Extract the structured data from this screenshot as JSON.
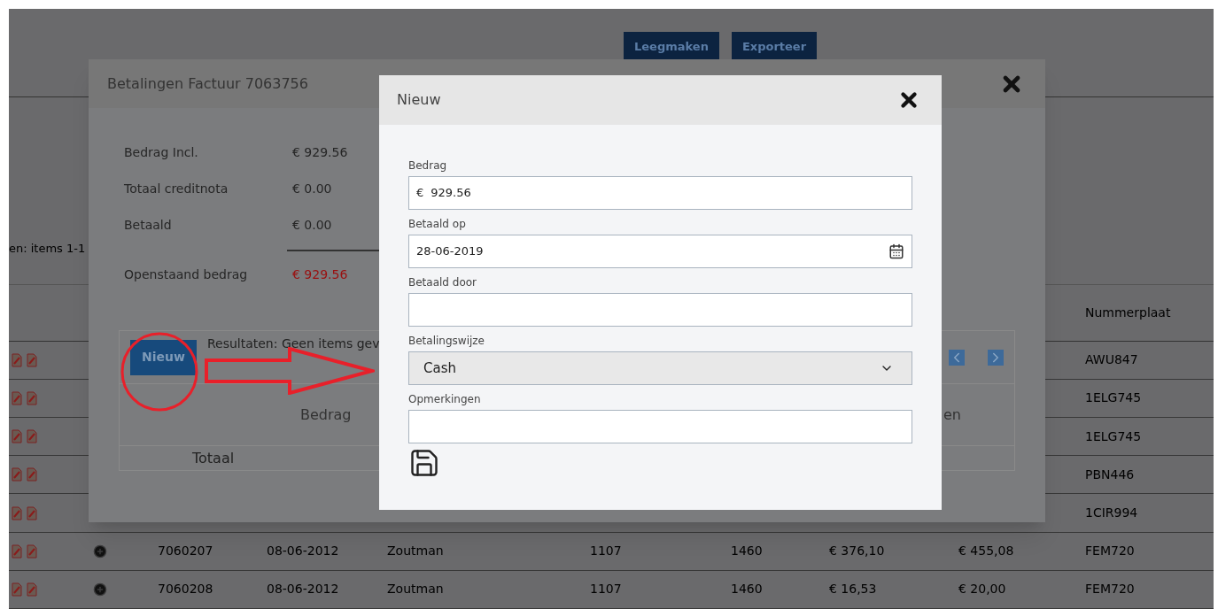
{
  "page": {
    "toolbar_buttons": [
      "Leegmaken",
      "Exporteer"
    ],
    "results_text": "en: items 1-1",
    "table": {
      "columns": [
        {
          "label": "Nummerplaat"
        }
      ],
      "rows": [
        {
          "plate": "AWU847"
        },
        {
          "plate": "1ELG745"
        },
        {
          "plate": "1ELG745"
        },
        {
          "plate": "PBN446"
        },
        {
          "plate": "1CIR994"
        },
        {
          "cells": [
            "7060207",
            "08-06-2012",
            "Zoutman",
            "1107",
            "1460",
            "€ 376,10",
            "€ 455,08"
          ],
          "plate": "FEM720"
        },
        {
          "cells": [
            "7060208",
            "08-06-2012",
            "Zoutman",
            "1107",
            "1460",
            "€ 16,53",
            "€ 20,00"
          ],
          "plate": "FEM720"
        }
      ]
    }
  },
  "payments_dialog": {
    "title": "Betalingen Factuur 7063756",
    "summary": [
      {
        "label": "Bedrag Incl.",
        "value": "€ 929.56",
        "kind": "normal"
      },
      {
        "label": "Totaal creditnota",
        "value": "€ 0.00",
        "kind": "normal"
      },
      {
        "label": "Betaald",
        "value": "€ 0.00",
        "kind": "normal"
      },
      {
        "label": "Openstaand bedrag",
        "value": "€ 929.56",
        "kind": "outstanding"
      }
    ],
    "new_button": "Nieuw",
    "results_text": "Resultaten: Geen items gev",
    "columns": [
      "Bedrag",
      "en"
    ],
    "footer": "Totaal"
  },
  "new_dialog": {
    "title": "Nieuw",
    "fields": [
      {
        "label": "Bedrag",
        "kind": "amount",
        "prefix": "€",
        "value": "929.56"
      },
      {
        "label": "Betaald op",
        "kind": "date",
        "value": "28-06-2019"
      },
      {
        "label": "Betaald door",
        "kind": "text"
      },
      {
        "label": "Betalingswijze",
        "kind": "select",
        "value": "Cash"
      },
      {
        "label": "Opmerkingen",
        "kind": "text"
      }
    ]
  }
}
